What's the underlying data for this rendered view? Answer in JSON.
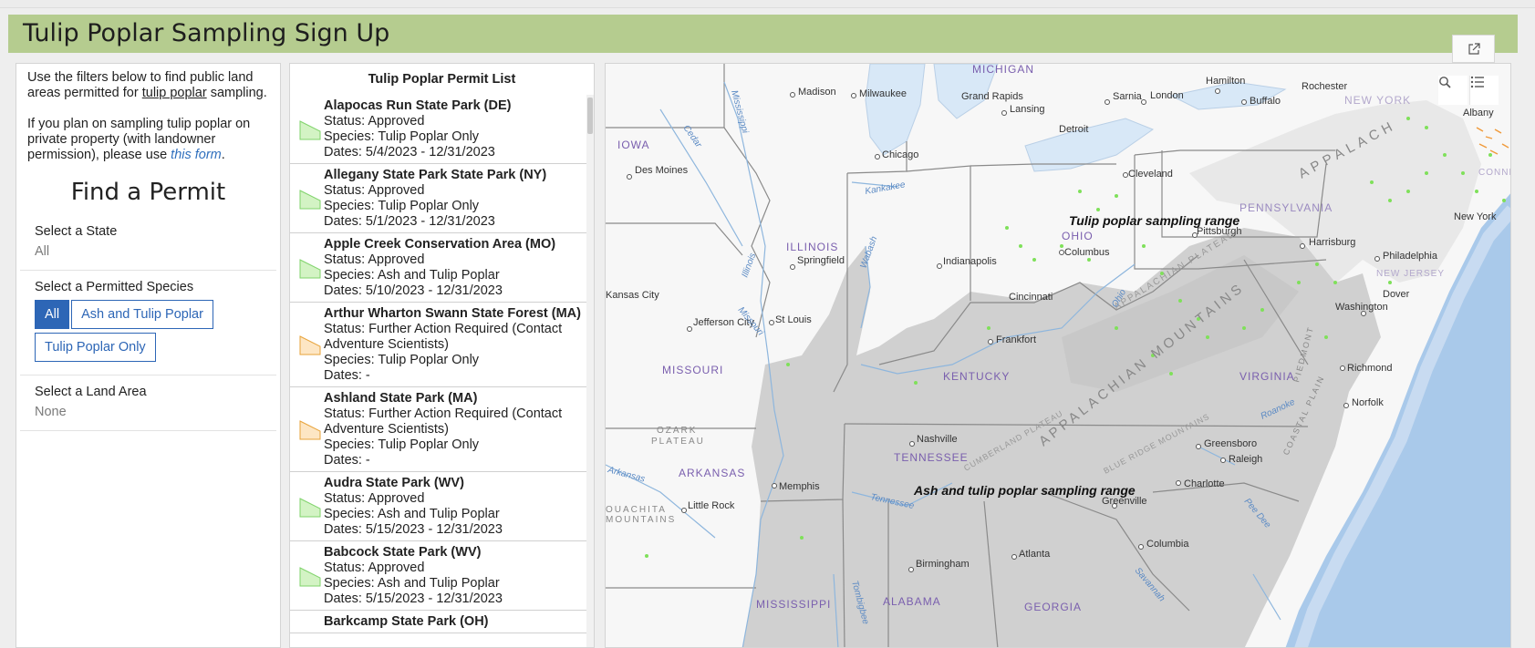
{
  "header": {
    "title": "Tulip Poplar Sampling Sign Up"
  },
  "filters": {
    "intro1_a": "Use the filters below to find public land areas permitted for ",
    "intro1_link": "tulip poplar",
    "intro1_b": " sampling.",
    "intro2_a": "If you plan on sampling tulip poplar on private property (with landowner permission), please use ",
    "intro2_link": "this form",
    "intro2_b": ".",
    "find_title": "Find a Permit",
    "state_label": "Select a State",
    "state_value": "All",
    "species_label": "Select a Permitted Species",
    "species_options": [
      "All",
      "Ash and Tulip Poplar",
      "Tulip Poplar Only"
    ],
    "area_label": "Select a Land Area",
    "area_value": "None"
  },
  "permit_list": {
    "title": "Tulip Poplar Permit List",
    "items": [
      {
        "name": "Alapocas Run State Park (DE)",
        "status": "Status: Approved",
        "species": "Species: Tulip Poplar Only",
        "dates": "Dates: 5/4/2023 - 12/31/2023",
        "symbol": "approved"
      },
      {
        "name": "Allegany State Park State Park (NY)",
        "status": "Status: Approved",
        "species": "Species: Tulip Poplar Only",
        "dates": "Dates: 5/1/2023 - 12/31/2023",
        "symbol": "approved"
      },
      {
        "name": "Apple Creek Conservation Area (MO)",
        "status": "Status: Approved",
        "species": "Species: Ash and Tulip Poplar",
        "dates": "Dates: 5/10/2023 - 12/31/2023",
        "symbol": "approved"
      },
      {
        "name": "Arthur Wharton Swann State Forest (MA)",
        "status": "Status: Further Action Required (Contact Adventure Scientists)",
        "species": "Species: Tulip Poplar Only",
        "dates": "Dates: -",
        "symbol": "action"
      },
      {
        "name": "Ashland State Park (MA)",
        "status": "Status: Further Action Required (Contact Adventure Scientists)",
        "species": "Species: Tulip Poplar Only",
        "dates": "Dates: -",
        "symbol": "action"
      },
      {
        "name": "Audra State Park (WV)",
        "status": "Status: Approved",
        "species": "Species: Ash and Tulip Poplar",
        "dates": "Dates: 5/15/2023 - 12/31/2023",
        "symbol": "approved"
      },
      {
        "name": "Babcock State Park (WV)",
        "status": "Status: Approved",
        "species": "Species: Ash and Tulip Poplar",
        "dates": "Dates: 5/15/2023 - 12/31/2023",
        "symbol": "approved"
      },
      {
        "name": "Barkcamp State Park (OH)",
        "status": "",
        "species": "",
        "dates": "",
        "symbol": "approved"
      }
    ]
  },
  "map": {
    "colors": {
      "water": "#a9c9ea",
      "lake": "#d8e8f7",
      "land": "#ffffff",
      "range": "#d3d3d3",
      "sites_approved": "#7fe05a",
      "sites_action": "#f09a3a",
      "river": "#8eb6dd"
    },
    "range_labels": [
      "Tulip poplar sampling range",
      "Ash and tulip poplar sampling range"
    ],
    "states": [
      "MICHIGAN",
      "IOWA",
      "ILLINOIS",
      "OHIO",
      "PENNSYLVANIA",
      "NEW YORK",
      "NEW JERSEY",
      "CONNEC",
      "MISSOURI",
      "KENTUCKY",
      "VIRGINIA",
      "TENNESSEE",
      "ARKANSAS",
      "MISSISSIPPI",
      "ALABAMA",
      "GEORGIA"
    ],
    "cities": [
      "Madison",
      "Milwaukee",
      "Grand Rapids",
      "Lansing",
      "Detroit",
      "Sarnia",
      "London",
      "Hamilton",
      "Buffalo",
      "Rochester",
      "Albany",
      "Chicago",
      "Des Moines",
      "Cleveland",
      "Pittsburgh",
      "Harrisburg",
      "New York",
      "Philadelphia",
      "Dover",
      "Washington",
      "Richmond",
      "Norfolk",
      "Columbus",
      "Indianapolis",
      "Springfield",
      "Cincinnati",
      "Frankfort",
      "Kansas City",
      "Jefferson City",
      "St Louis",
      "Nashville",
      "Memphis",
      "Little Rock",
      "Charlotte",
      "Greensboro",
      "Raleigh",
      "Greenville",
      "Columbia",
      "Atlanta",
      "Birmingham"
    ],
    "terrain": [
      "APPALACHIAN MOUNTAINS",
      "APPALACHIAN PLATEAU",
      "CUMBERLAND PLATEAU",
      "BLUE RIDGE MOUNTAINS",
      "OZARK",
      "PLATEAU",
      "OUACHITA",
      "MOUNTAINS",
      "APPALACH",
      "PIEDMONT",
      "COASTAL PLAIN"
    ],
    "rivers": [
      "Mississippi",
      "Cedar",
      "Illinois",
      "Kankakee",
      "Wabash",
      "Ohio",
      "Tennessee",
      "Tombigbee",
      "Savannah",
      "Roanoke",
      "Pee Dee",
      "Arkansas",
      "Missouri"
    ],
    "buttons": [
      "search",
      "layers"
    ]
  }
}
